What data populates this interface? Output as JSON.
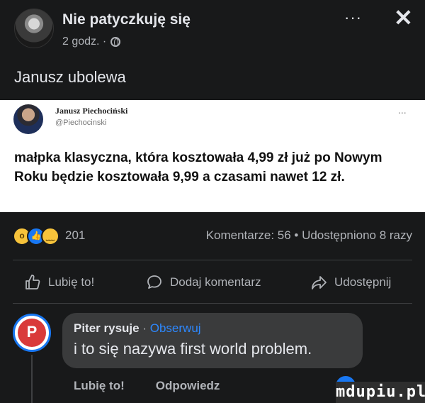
{
  "header": {
    "page_name": "Nie patyczkuję się",
    "time": "2 godz. ·",
    "more": "···",
    "close": "✕"
  },
  "post": {
    "text": "Janusz ubolewa"
  },
  "tweet": {
    "author": "Janusz Piechociński",
    "handle": "@Piechocinski",
    "more": "...",
    "text": "małpka klasyczna, która kosztowała 4,99 zł już po Nowym Roku będzie kosztowała 9,99 a czasami nawet 12 zł."
  },
  "stats": {
    "reaction_icons": [
      "wow-emoji-icon",
      "like-icon",
      "sad-emoji-icon"
    ],
    "reaction_count": "201",
    "summary": "Komentarze: 56 • Udostępniono 8 razy"
  },
  "actions": {
    "like": "Lubię to!",
    "comment": "Dodaj komentarz",
    "share": "Udostępnij"
  },
  "comment": {
    "author": "Piter rysuje",
    "separator": "·",
    "follow": "Obserwuj",
    "text": "i to się nazywa first world problem.",
    "like": "Lubię to!",
    "reply": "Odpowiedz"
  },
  "watermark": "mdupiu.pl",
  "colors": {
    "background": "#18191a",
    "accent": "#2d88ff",
    "bubble": "#3a3b3c"
  }
}
